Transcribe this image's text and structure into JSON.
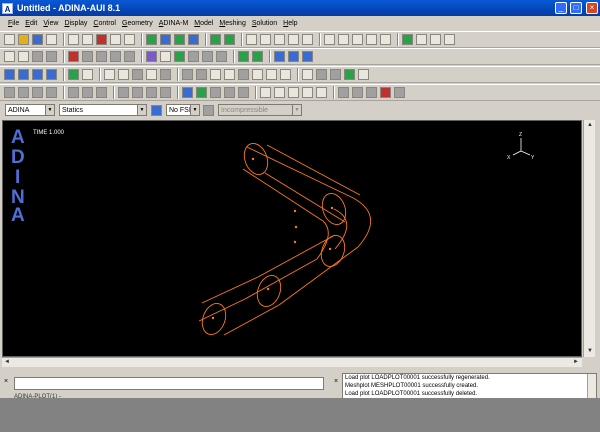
{
  "window": {
    "title": "Untitled - ADINA-AUI  8.1",
    "app_icon": "A"
  },
  "menubar": [
    {
      "ul": "F",
      "rest": "ile"
    },
    {
      "ul": "E",
      "rest": "dit"
    },
    {
      "ul": "V",
      "rest": "iew"
    },
    {
      "ul": "D",
      "rest": "isplay"
    },
    {
      "ul": "C",
      "rest": "ontrol"
    },
    {
      "ul": "G",
      "rest": "eometry"
    },
    {
      "ul": "A",
      "rest": "DINA-M"
    },
    {
      "ul": "M",
      "rest": "odel"
    },
    {
      "ul": "M",
      "rest": "eshing"
    },
    {
      "ul": "S",
      "rest": "olution"
    },
    {
      "ul": "H",
      "rest": "elp"
    }
  ],
  "progbar": {
    "program": "ADINA",
    "analysis": "Statics",
    "fsi": "No FSI",
    "fluid": "Incompressible"
  },
  "graphics": {
    "logo_letters": [
      "A",
      "D",
      "I",
      "N",
      "A"
    ],
    "time_label": "TIME 1.000",
    "triad": {
      "x": "X",
      "y": "Y",
      "z": "Z"
    }
  },
  "log": {
    "lines": [
      "Load plot LOADPLOT00001 successfully regenerated.",
      "Meshplot MESHPLOT00001 successfully created.",
      "Load plot LOADPLOT00001 successfully deleted."
    ]
  },
  "status": "ADINA-PLOT(1) -",
  "icons": {
    "close": "×",
    "scroll_up": "▲",
    "scroll_down": "▼",
    "scroll_left": "◄",
    "scroll_right": "►",
    "combo_arrow": "▼"
  },
  "colors": {
    "mesh": "#ff7a1a",
    "logo": "#4f6fd8",
    "graphics_bg": "#000000"
  }
}
